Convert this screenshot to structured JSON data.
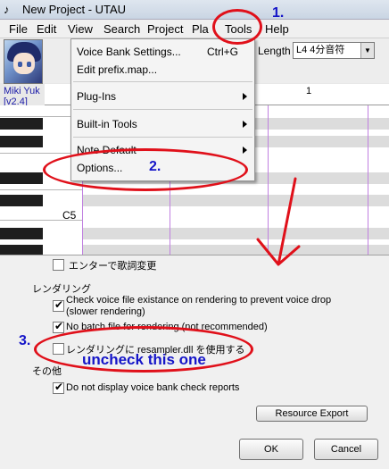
{
  "window": {
    "title": "New Project - UTAU",
    "app_icon": "♪"
  },
  "menubar": {
    "items": [
      {
        "label": "File"
      },
      {
        "label": "Edit"
      },
      {
        "label": "View"
      },
      {
        "label": "Search"
      },
      {
        "label": "Project"
      },
      {
        "label": "Pla"
      },
      {
        "label": "Tools"
      },
      {
        "label": "Help"
      }
    ]
  },
  "toolbar": {
    "length_label": "Length",
    "length_value": "L4  4分音符"
  },
  "singer": {
    "name": "Miki Yuk",
    "version": "[v2.4]"
  },
  "roll": {
    "measure_number": "1",
    "c5_label": "C5"
  },
  "tools_menu": {
    "voicebank_settings": "Voice Bank Settings...",
    "voicebank_shortcut": "Ctrl+G",
    "edit_prefix_map": "Edit prefix.map...",
    "plug_ins": "Plug-Ins",
    "built_in_tools": "Built-in Tools",
    "note_default": "Note Default",
    "options": "Options..."
  },
  "options_dialog": {
    "lyric_change_on_enter": "エンターで歌詞変更",
    "rendering_header": "レンダリング",
    "check_voice_file_line1": "Check voice file existance on rendering to prevent voice drop",
    "check_voice_file_line2": "(slower rendering)",
    "no_batch_file": "No batch file for rendering (not recommended)",
    "use_resampler_dll": "レンダリングに resampler.dll を使用する",
    "other_header": "その他",
    "no_voicebank_check_reports": "Do not display voice bank check reports",
    "resource_export_button": "Resource Export",
    "ok_button": "OK",
    "cancel_button": "Cancel"
  },
  "annotations": {
    "step1": "1.",
    "step2": "2.",
    "step3": "3.",
    "uncheck_note": "uncheck this one",
    "marker_color": "#e0101a",
    "text_color": "#1515c8"
  },
  "colors": {
    "menu_bg": "#f4f4f4",
    "grid_lane": "#dcdcdc",
    "bar_line": "#c080e0",
    "singer_text": "#1a1aa8"
  }
}
